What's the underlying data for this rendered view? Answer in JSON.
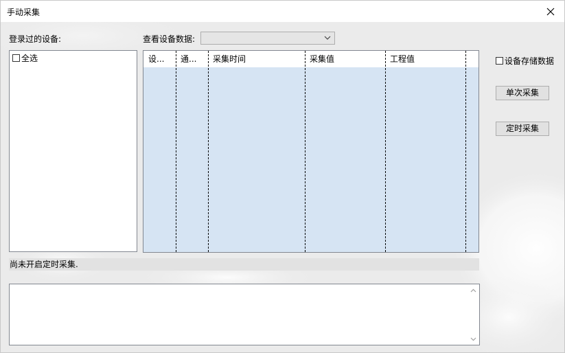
{
  "window": {
    "title": "手动采集"
  },
  "devices": {
    "label": "登录过的设备:",
    "select_all": "全选"
  },
  "view": {
    "label": "查看设备数据:",
    "combo_value": ""
  },
  "grid": {
    "columns": [
      "设...",
      "通...",
      "采集时间",
      "采集值",
      "工程值"
    ]
  },
  "actions": {
    "store_checkbox": "设备存储数据",
    "single_button": "单次采集",
    "timed_button": "定时采集"
  },
  "status": {
    "text": "尚未开启定时采集."
  },
  "log": {
    "text": ""
  }
}
